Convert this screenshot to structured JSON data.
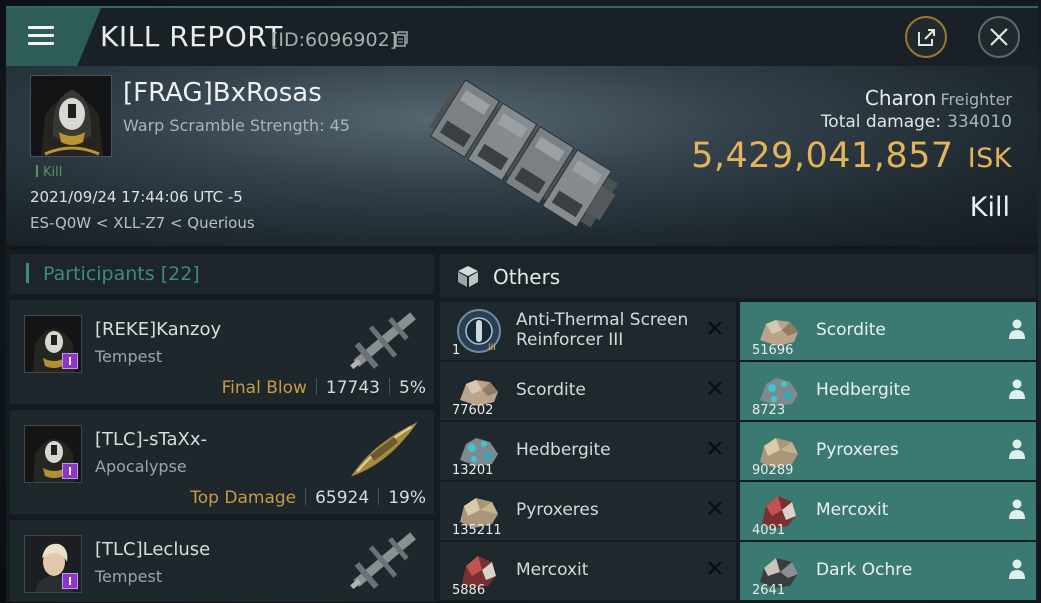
{
  "header": {
    "title": "KILL REPORT",
    "kill_id": "[ID:6096902]"
  },
  "victim": {
    "name": "[FRAG]BxRosas",
    "warp_scramble": "Warp Scramble Strength: 45",
    "kill_tag": "Kill",
    "datetime": "2021/09/24 17:44:06 UTC -5",
    "location": "ES-Q0W < XLL-Z7 < Querious"
  },
  "ship": {
    "name": "Charon",
    "class": "Freighter",
    "total_damage_label": "Total damage:",
    "total_damage": "334010",
    "isk_value": "5,429,041,857",
    "isk_unit": "ISK",
    "result": "Kill"
  },
  "participants": {
    "label": "Participants",
    "count": "[22]",
    "rows": [
      {
        "name": "[REKE]Kanzoy",
        "ship": "Tempest",
        "tag": "Final Blow",
        "damage": "17743",
        "percent": "5%"
      },
      {
        "name": "[TLC]-sTaXx-",
        "ship": "Apocalypse",
        "tag": "Top Damage",
        "damage": "65924",
        "percent": "19%"
      },
      {
        "name": "[TLC]Lecluse",
        "ship": "Tempest"
      }
    ]
  },
  "others": {
    "label": "Others",
    "left": [
      {
        "name1": "Anti-Thermal Screen",
        "name2": "Reinforcer III",
        "qty": "1",
        "icon": "module-icon"
      },
      {
        "name1": "Scordite",
        "qty": "77602",
        "icon": "ore-icon"
      },
      {
        "name1": "Hedbergite",
        "qty": "13201",
        "icon": "ore-icon"
      },
      {
        "name1": "Pyroxeres",
        "qty": "135211",
        "icon": "ore-icon"
      },
      {
        "name1": "Mercoxit",
        "qty": "5886",
        "icon": "ore-icon"
      }
    ],
    "right": [
      {
        "name1": "Scordite",
        "qty": "51696",
        "icon": "ore-icon"
      },
      {
        "name1": "Hedbergite",
        "qty": "8723",
        "icon": "ore-icon"
      },
      {
        "name1": "Pyroxeres",
        "qty": "90289",
        "icon": "ore-icon"
      },
      {
        "name1": "Mercoxit",
        "qty": "4091",
        "icon": "ore-icon"
      },
      {
        "name1": "Dark Ochre",
        "qty": "2641",
        "icon": "ore-icon"
      }
    ]
  },
  "colors": {
    "accent": "#3c8b82",
    "isk": "#e2b45b",
    "tag": "#c99a44",
    "cargo_row": "#3a7a72",
    "corp_badge": "#8e35c9"
  }
}
